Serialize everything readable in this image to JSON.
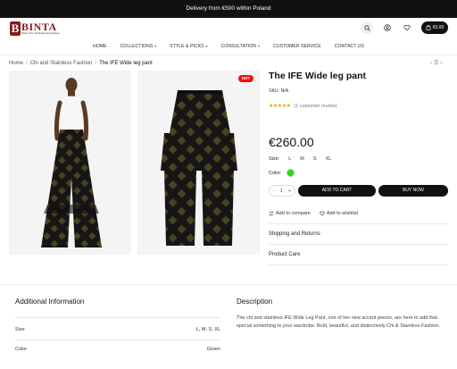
{
  "announcement": "Delivery from €500 within Poland",
  "brand": {
    "name": "BINTA",
    "mark": "B",
    "tagline": "Wear Your Heritage Everywhere"
  },
  "header": {
    "cart_total": "€0.00"
  },
  "nav": [
    "HOME",
    "COLLECTIONS",
    "STYLE & PICKS",
    "CONSULTATION",
    "CUSTOMER SERVICE",
    "CONTACT US"
  ],
  "breadcrumb": {
    "home": "Home",
    "category": "Chi and Stainless Fashion",
    "current": "The IFE Wide leg pant",
    "separator": "/"
  },
  "badge": "HOT",
  "product": {
    "title": "The IFE Wide leg pant",
    "sku_label": "SKU:",
    "sku": "N/A",
    "stars": "★★★★★",
    "reviews": "(1 customer review)",
    "price": "€260.00",
    "size_label": "Size:",
    "sizes": [
      "L",
      "M",
      "S",
      "XL"
    ],
    "color_label": "Color:",
    "color_hex": "#22dd11",
    "quantity": "1",
    "add_to_cart": "ADD TO CART",
    "buy_now": "BUY NOW",
    "compare": "Add to compare",
    "wishlist": "Add to wishlist",
    "accordion": [
      "Shipping and Returns",
      "Product Care"
    ]
  },
  "additional": {
    "heading": "Additional Information",
    "rows": [
      {
        "label": "Size",
        "value": "L, M, S, XL"
      },
      {
        "label": "Color",
        "value": "Green"
      }
    ]
  },
  "description": {
    "heading": "Description",
    "text": "The chi and stainless IFE Wide Leg Pant, one of her new accent pieces, are here to add that special something to your wardrobe. Bold, beautiful, and distinctively Chi & Stainless Fashion."
  },
  "colors": {
    "accent": "#111111",
    "brand": "#8b1a1a",
    "badge": "#ee1111",
    "star": "#e6a100"
  }
}
